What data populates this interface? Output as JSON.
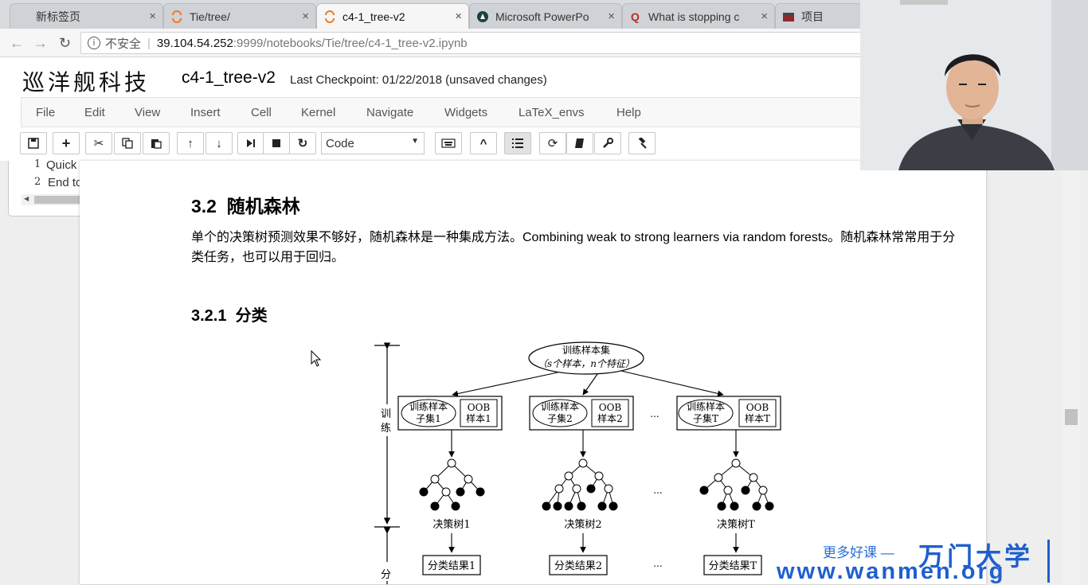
{
  "browser": {
    "tabs": [
      {
        "label": "新标签页",
        "icon": "blank-icon",
        "active": false
      },
      {
        "label": "Tie/tree/",
        "icon": "jupyter-icon",
        "active": false
      },
      {
        "label": "c4-1_tree-v2",
        "icon": "jupyter-icon",
        "active": true
      },
      {
        "label": "Microsoft PowerPo",
        "icon": "msu-icon",
        "active": false
      },
      {
        "label": "What is stopping c",
        "icon": "quora-icon",
        "active": false
      },
      {
        "label": "项目",
        "icon": "project-icon",
        "active": false
      }
    ],
    "tab_close": "×",
    "security_label": "不安全",
    "url_host": "39.104.54.252",
    "url_rest": ":9999/notebooks/Tie/tree/c4-1_tree-v2.ipynb"
  },
  "notebook": {
    "logo": "巡洋舰科技",
    "title": "c4-1_tree-v2",
    "checkpoint": "Last Checkpoint: 01/22/2018 (unsaved changes)",
    "menu": [
      "File",
      "Edit",
      "View",
      "Insert",
      "Cell",
      "Kernel",
      "Navigate",
      "Widgets",
      "LaTeX_envs",
      "Help"
    ],
    "cell_type": "Code"
  },
  "toc": {
    "items": [
      {
        "num": "1",
        "label": "Quick Start"
      },
      {
        "num": "2",
        "label": "End to end"
      }
    ]
  },
  "content": {
    "h32_num": "3.2",
    "h32_text": "随机森林",
    "paragraph": "单个的决策树预测效果不够好，随机森林是一种集成方法。Combining weak to strong learners via random forests。随机森林常常用于分类任务，也可以用于回归。",
    "h321_num": "3.2.1",
    "h321_text": "分类"
  },
  "figure": {
    "top_node_1": "训练样本集",
    "top_node_2": "（s个样本，n个特征）",
    "phase_train": [
      "训",
      "练"
    ],
    "phase_classify": "分",
    "subsets": [
      {
        "sub1": "训练样本",
        "sub2": "子集1",
        "oob1": "OOB",
        "oob2": "样本1",
        "tree": "决策树1",
        "result": "分类结果1"
      },
      {
        "sub1": "训练样本",
        "sub2": "子集2",
        "oob1": "OOB",
        "oob2": "样本2",
        "tree": "决策树2",
        "result": "分类结果2"
      },
      {
        "sub1": "训练样本",
        "sub2": "子集T",
        "oob1": "OOB",
        "oob2": "样本T",
        "tree": "决策树T",
        "result": "分类结果T"
      }
    ],
    "ellipsis": "..."
  },
  "watermark": {
    "line1": "更多好课 —",
    "brand": "万门大学",
    "url": "www.wanmen.org"
  },
  "colors": {
    "accent": "#1f5fcf",
    "jupyter_orange": "#f37726"
  }
}
